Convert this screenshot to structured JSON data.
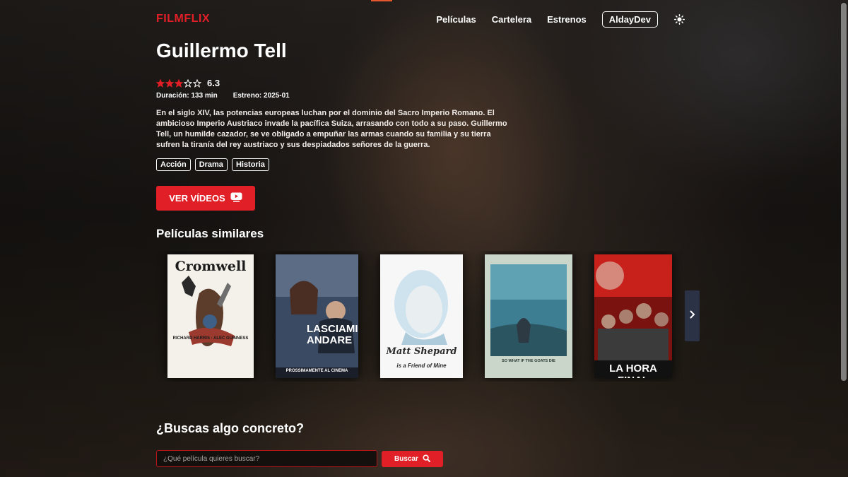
{
  "header": {
    "logo": "FILMFLIX",
    "nav": [
      {
        "label": "Películas"
      },
      {
        "label": "Cartelera"
      },
      {
        "label": "Estrenos"
      }
    ],
    "user_label": "AldayDev",
    "theme_icon": "sun-icon"
  },
  "movie": {
    "title": "Guillermo Tell",
    "stars_filled": 3,
    "stars_total": 5,
    "rating": "6.3",
    "duration": "Duración: 133 min",
    "release": "Estreno: 2025-01",
    "synopsis": "En el siglo XIV, las potencias europeas luchan por el dominio del Sacro Imperio Romano. El ambicioso Imperio Austriaco invade la pacífica Suiza, arrasando con todo a su paso. Guillermo Tell, un humilde cazador, se ve obligado a empuñar las armas cuando su familia y su tierra sufren la tiranía del rey austriaco y sus despiadados señores de la guerra.",
    "genres": [
      "Acción",
      "Drama",
      "Historia"
    ],
    "video_button": "VER VÍDEOS",
    "video_icon": "youtube-icon"
  },
  "similar": {
    "title": "Películas similares",
    "posters": [
      {
        "title": "Cromwell",
        "names": "RICHARD HARRIS · ALEC GUINNESS",
        "bg": "#f4f1ea",
        "fg": "#1b1b1b"
      },
      {
        "title": "LASCIAMI ANDARE",
        "names": "PROSSIMAMENTE AL CINEMA",
        "bg": "#3a4a63",
        "fg": "#ffffff"
      },
      {
        "title": "Matt Shepard",
        "names": "is a Friend of Mine",
        "bg": "#f7f7f7",
        "fg": "#2a2a2a"
      },
      {
        "title": "SO WHAT IF THE GOATS DIE",
        "names": "",
        "bg": "#c9d6c9",
        "fg": "#2b3b36"
      },
      {
        "title": "LA HORA FINAL",
        "names": "",
        "bg": "#7a1210",
        "fg": "#ffffff"
      }
    ],
    "next_icon": "chevron-right-icon"
  },
  "search": {
    "title": "¿Buscas algo concreto?",
    "placeholder": "¿Qué película quieres buscar?",
    "button": "Buscar",
    "icon": "search-icon"
  },
  "colors": {
    "accent": "#e01f26",
    "star_filled": "#e01f26"
  }
}
